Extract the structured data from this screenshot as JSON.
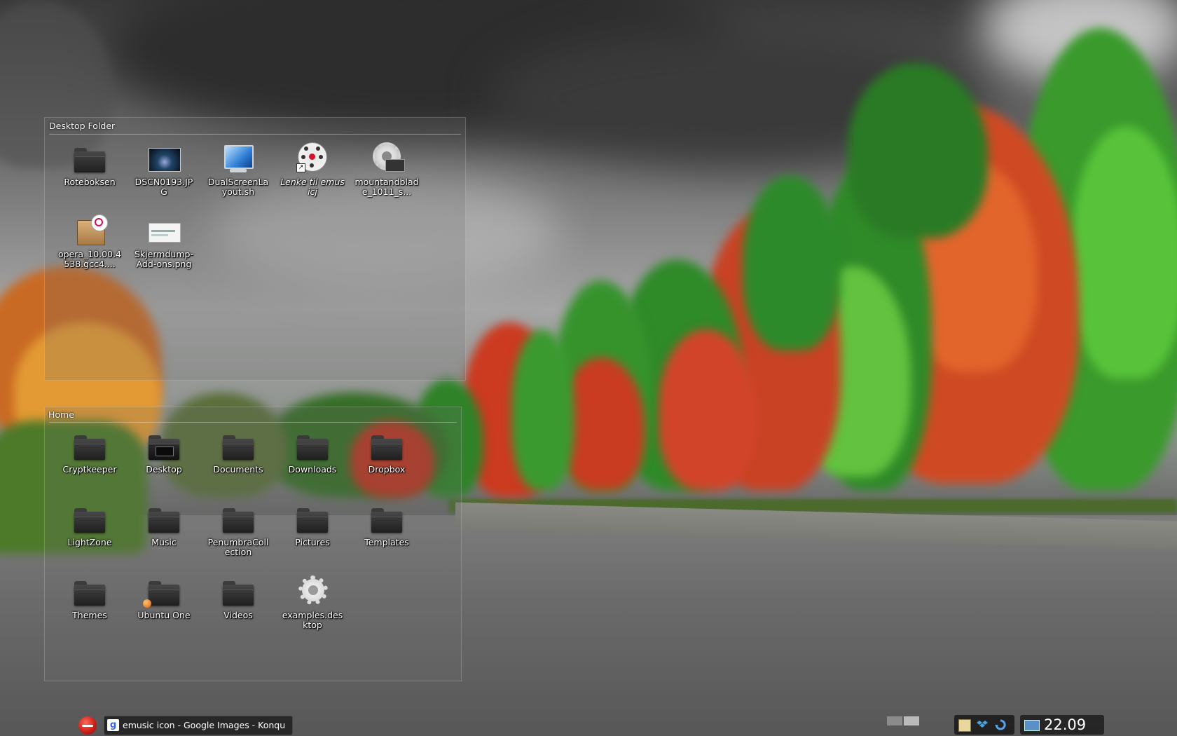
{
  "desktop_folder": {
    "title": "Desktop Folder",
    "items": [
      {
        "label": "Roteboksen",
        "icon": "folder-icon"
      },
      {
        "label": "DSCN0193.JPG",
        "icon": "image-thumbnail-icon"
      },
      {
        "label": "DualScreenLayout.sh",
        "icon": "monitor-script-icon"
      },
      {
        "label": "Lenke til emusicj",
        "icon": "emusic-link-icon"
      },
      {
        "label": "mountandblade_1011_s...",
        "icon": "executable-gear-icon"
      },
      {
        "label": "opera_10.00.4538.gcc4....",
        "icon": "deb-package-icon"
      },
      {
        "label": "Skjermdump-Add-ons.png",
        "icon": "screenshot-thumbnail-icon"
      }
    ]
  },
  "home_folder": {
    "title": "Home",
    "items": [
      {
        "label": "Cryptkeeper",
        "icon": "folder-icon"
      },
      {
        "label": "Desktop",
        "icon": "desktop-folder-icon"
      },
      {
        "label": "Documents",
        "icon": "folder-icon"
      },
      {
        "label": "Downloads",
        "icon": "folder-icon"
      },
      {
        "label": "Dropbox",
        "icon": "folder-icon"
      },
      {
        "label": "LightZone",
        "icon": "folder-icon"
      },
      {
        "label": "Music",
        "icon": "folder-icon"
      },
      {
        "label": "PenumbraCollection",
        "icon": "folder-icon"
      },
      {
        "label": "Pictures",
        "icon": "folder-icon"
      },
      {
        "label": "Templates",
        "icon": "folder-icon"
      },
      {
        "label": "Themes",
        "icon": "folder-icon"
      },
      {
        "label": "Ubuntu One",
        "icon": "ubuntu-one-folder-icon"
      },
      {
        "label": "Videos",
        "icon": "folder-icon"
      },
      {
        "label": "examples.desktop",
        "icon": "gear-icon"
      }
    ]
  },
  "taskbar": {
    "launcher_icon": "kde-menu-icon",
    "tasks": [
      {
        "label": "emusic icon - Google Images - Konqu",
        "icon": "google-icon",
        "icon_glyph": "g"
      }
    ],
    "tray_icons": [
      "klipper-clipboard-icon",
      "dropbox-icon",
      "update-notifier-icon"
    ],
    "clock": "22.09"
  },
  "colors": {
    "panel_bg": "rgba(110,110,110,0.22)",
    "taskbar_bg": "#191919",
    "kmenu_red": "#d0201a"
  }
}
